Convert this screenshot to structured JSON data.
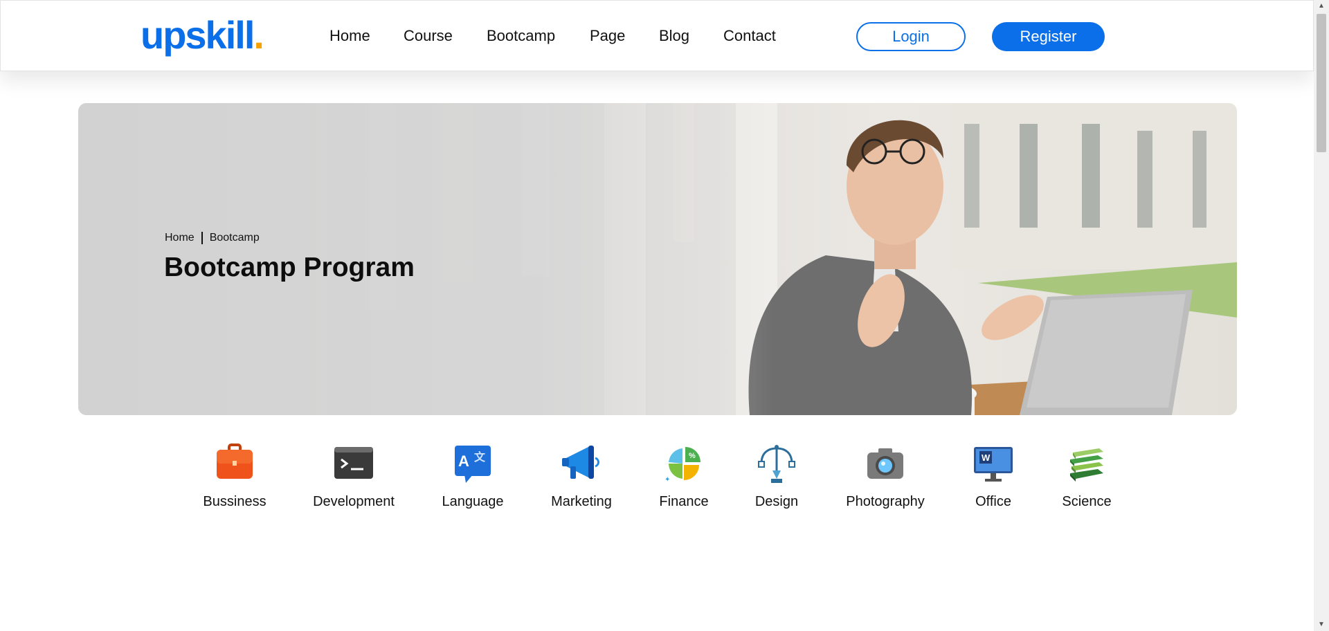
{
  "brand": {
    "logo_text": "upskill",
    "logo_dot": ".",
    "color": "#0a6fe8",
    "accent": "#f5a100"
  },
  "nav": {
    "items": [
      "Home",
      "Course",
      "Bootcamp",
      "Page",
      "Blog",
      "Contact"
    ]
  },
  "auth": {
    "login_label": "Login",
    "register_label": "Register"
  },
  "hero": {
    "breadcrumb": [
      "Home",
      "Bootcamp"
    ],
    "title": "Bootcamp Program"
  },
  "categories": [
    {
      "label": "Bussiness",
      "icon": "briefcase-icon"
    },
    {
      "label": "Development",
      "icon": "terminal-icon"
    },
    {
      "label": "Language",
      "icon": "translate-icon"
    },
    {
      "label": "Marketing",
      "icon": "megaphone-icon"
    },
    {
      "label": "Finance",
      "icon": "pie-chart-icon"
    },
    {
      "label": "Design",
      "icon": "pen-tool-icon"
    },
    {
      "label": "Photography",
      "icon": "camera-icon"
    },
    {
      "label": "Office",
      "icon": "monitor-word-icon"
    },
    {
      "label": "Science",
      "icon": "books-icon"
    }
  ]
}
